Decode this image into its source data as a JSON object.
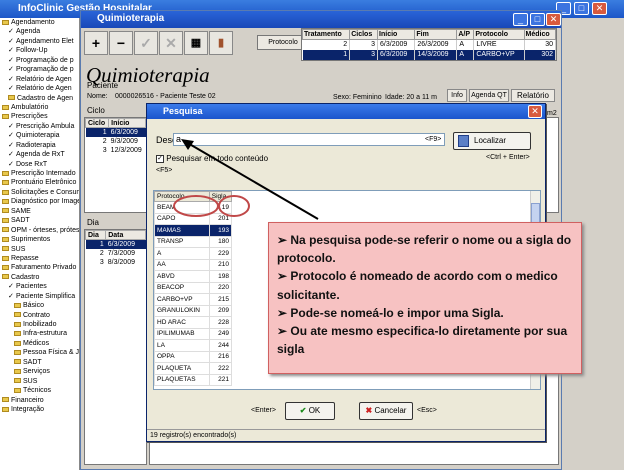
{
  "window": {
    "title": "InfoClinic Gestão Hospitalar"
  },
  "tree": {
    "items": [
      {
        "kind": "folder",
        "label": "Agendamento",
        "indent": 0
      },
      {
        "kind": "check",
        "label": "Agenda",
        "indent": 1
      },
      {
        "kind": "check",
        "label": "Agendamento Elet",
        "indent": 1
      },
      {
        "kind": "check",
        "label": "Follow-Up",
        "indent": 1
      },
      {
        "kind": "check",
        "label": "Programação de p",
        "indent": 1
      },
      {
        "kind": "check",
        "label": "Programação de p",
        "indent": 1
      },
      {
        "kind": "check",
        "label": "Relatório de Agen",
        "indent": 1
      },
      {
        "kind": "check",
        "label": "Relatório de Agen",
        "indent": 1
      },
      {
        "kind": "folder",
        "label": "Cadastro de Agen",
        "indent": 1
      },
      {
        "kind": "folder",
        "label": "Ambulatório",
        "indent": 0
      },
      {
        "kind": "folder",
        "label": "Prescrições",
        "indent": 0
      },
      {
        "kind": "check",
        "label": "Prescrição Ambula",
        "indent": 1
      },
      {
        "kind": "check",
        "label": "Quimioterapia",
        "indent": 1
      },
      {
        "kind": "check",
        "label": "Radioterapia",
        "indent": 1
      },
      {
        "kind": "check",
        "label": "Agenda de RxT",
        "indent": 1
      },
      {
        "kind": "check",
        "label": "Dose RxT",
        "indent": 1
      },
      {
        "kind": "folder",
        "label": "Prescrição Internado",
        "indent": 0
      },
      {
        "kind": "folder",
        "label": "Prontuário Eletrônico",
        "indent": 0
      },
      {
        "kind": "folder",
        "label": "Solicitações e Consum",
        "indent": 0
      },
      {
        "kind": "folder",
        "label": "Diagnóstico por Image",
        "indent": 0
      },
      {
        "kind": "folder",
        "label": "SAME",
        "indent": 0
      },
      {
        "kind": "folder",
        "label": "SADT",
        "indent": 0
      },
      {
        "kind": "folder",
        "label": "OPM - órteses, prótes",
        "indent": 0
      },
      {
        "kind": "folder",
        "label": "Suprimentos",
        "indent": 0
      },
      {
        "kind": "folder",
        "label": "SUS",
        "indent": 0
      },
      {
        "kind": "folder",
        "label": "Repasse",
        "indent": 0
      },
      {
        "kind": "folder",
        "label": "Faturamento Privado",
        "indent": 0
      },
      {
        "kind": "folder",
        "label": "Cadastro",
        "indent": 0
      },
      {
        "kind": "check",
        "label": "Pacientes",
        "indent": 1
      },
      {
        "kind": "check",
        "label": "Paciente Simplifica",
        "indent": 1
      },
      {
        "kind": "folder",
        "label": "Básico",
        "indent": 2
      },
      {
        "kind": "folder",
        "label": "Contrato",
        "indent": 2
      },
      {
        "kind": "folder",
        "label": "Inobilizado",
        "indent": 2
      },
      {
        "kind": "folder",
        "label": "Infra-estrutura",
        "indent": 2
      },
      {
        "kind": "folder",
        "label": "Médicos",
        "indent": 2
      },
      {
        "kind": "folder",
        "label": "Pessoa Física & Ju",
        "indent": 2
      },
      {
        "kind": "folder",
        "label": "SADT",
        "indent": 2
      },
      {
        "kind": "folder",
        "label": "Serviços",
        "indent": 2
      },
      {
        "kind": "folder",
        "label": "SUS",
        "indent": 2
      },
      {
        "kind": "folder",
        "label": "Técnicos",
        "indent": 2
      },
      {
        "kind": "folder",
        "label": "Financeiro",
        "indent": 0
      },
      {
        "kind": "folder",
        "label": "Integração",
        "indent": 0
      }
    ]
  },
  "inner": {
    "title": "Quimioterapia",
    "big_title": "Quimioterapia",
    "protocolo_button": "Protocolo",
    "treatments": {
      "headers": [
        "Tratamento",
        "Ciclos",
        "Início",
        "Fim",
        "A/P",
        "Protocolo",
        "Médico"
      ],
      "rows": [
        {
          "cells": [
            "2",
            "3",
            "6/3/2009",
            "26/3/2009",
            "A",
            "LIVRE",
            "30"
          ],
          "selected": false
        },
        {
          "cells": [
            "1",
            "3",
            "6/3/2009",
            "14/3/2009",
            "A",
            "CARBO+VP",
            "302"
          ],
          "selected": true
        }
      ]
    },
    "patient_label": "Paciente",
    "nome_label": "Nome:",
    "nome_value": "0000026516 - Paciente Teste 02",
    "sexo": "Sexo: Feminino",
    "idade": "Idade: 20 a 11 m",
    "tabs": [
      "Info",
      "Agenda QT",
      "Relatório"
    ],
    "m2": "m2",
    "ciclo_label": "Ciclo",
    "ciclo": {
      "headers": [
        "Ciclo",
        "Início"
      ],
      "rows": [
        {
          "cells": [
            "1",
            "6/3/2009"
          ],
          "selected": true
        },
        {
          "cells": [
            "2",
            "9/3/2009"
          ],
          "selected": false
        },
        {
          "cells": [
            "3",
            "12/3/2009"
          ],
          "selected": false
        }
      ]
    },
    "dia_label": "Dia",
    "dia": {
      "headers": [
        "Dia",
        "Data"
      ],
      "rows": [
        {
          "cells": [
            "1",
            "6/3/2009"
          ],
          "selected": true
        },
        {
          "cells": [
            "2",
            "7/3/2009"
          ],
          "selected": false
        },
        {
          "cells": [
            "3",
            "8/3/2009"
          ],
          "selected": false
        }
      ]
    }
  },
  "dialog": {
    "title": "Pesquisa",
    "descricao_label": "Descrição:",
    "descricao_value": "a",
    "f9_hint": "<F9>",
    "localizar": "Localizar",
    "ctrl_enter": "<Ctrl + Enter>",
    "pesquisar_label": "Pesquisar em todo conteúdo",
    "f5_hint": "<F5>",
    "grid": {
      "headers": [
        "Protocolo",
        "Sigla"
      ],
      "rows": [
        {
          "cells": [
            "BEAM",
            "19"
          ],
          "selected": false
        },
        {
          "cells": [
            "CAPO",
            "201"
          ],
          "selected": false
        },
        {
          "cells": [
            "MAMAS",
            "193"
          ],
          "selected": true
        },
        {
          "cells": [
            "TRANSP",
            "180"
          ],
          "selected": false
        },
        {
          "cells": [
            "A",
            "229"
          ],
          "selected": false
        },
        {
          "cells": [
            "AA",
            "210"
          ],
          "selected": false
        },
        {
          "cells": [
            "ABVD",
            "198"
          ],
          "selected": false
        },
        {
          "cells": [
            "BEACOP",
            "220"
          ],
          "selected": false
        },
        {
          "cells": [
            "CARBO+VP",
            "215"
          ],
          "selected": false
        },
        {
          "cells": [
            "GRANULOKIN",
            "209"
          ],
          "selected": false
        },
        {
          "cells": [
            "HD ARAC",
            "228"
          ],
          "selected": false
        },
        {
          "cells": [
            "IPILIMUMAB",
            "249"
          ],
          "selected": false
        },
        {
          "cells": [
            "LA",
            "244"
          ],
          "selected": false
        },
        {
          "cells": [
            "OPPA",
            "216"
          ],
          "selected": false
        },
        {
          "cells": [
            "PLAQUETA",
            "222"
          ],
          "selected": false
        },
        {
          "cells": [
            "PLAQUETAS",
            "221"
          ],
          "selected": false
        }
      ]
    },
    "enter_hint": "<Enter>",
    "ok": "OK",
    "cancelar": "Cancelar",
    "esc_hint": "<Esc>",
    "status": "19 registro(s) encontrado(s)"
  },
  "note": {
    "lines": [
      "➢  Na pesquisa pode-se referir o nome ou a sigla do protocolo.",
      "➢    Protocolo é nomeado de acordo com o medico solicitante.",
      "➢    Pode-se nomeá-lo e impor uma Sigla.",
      "➢    Ou ate mesmo especifica-lo diretamente por sua sigla"
    ]
  },
  "colors": {
    "title_bar": "#1c56c8",
    "selection": "#0a246a",
    "note_bg": "#f7c2c2",
    "highlight_ellipse": "#c04848"
  }
}
